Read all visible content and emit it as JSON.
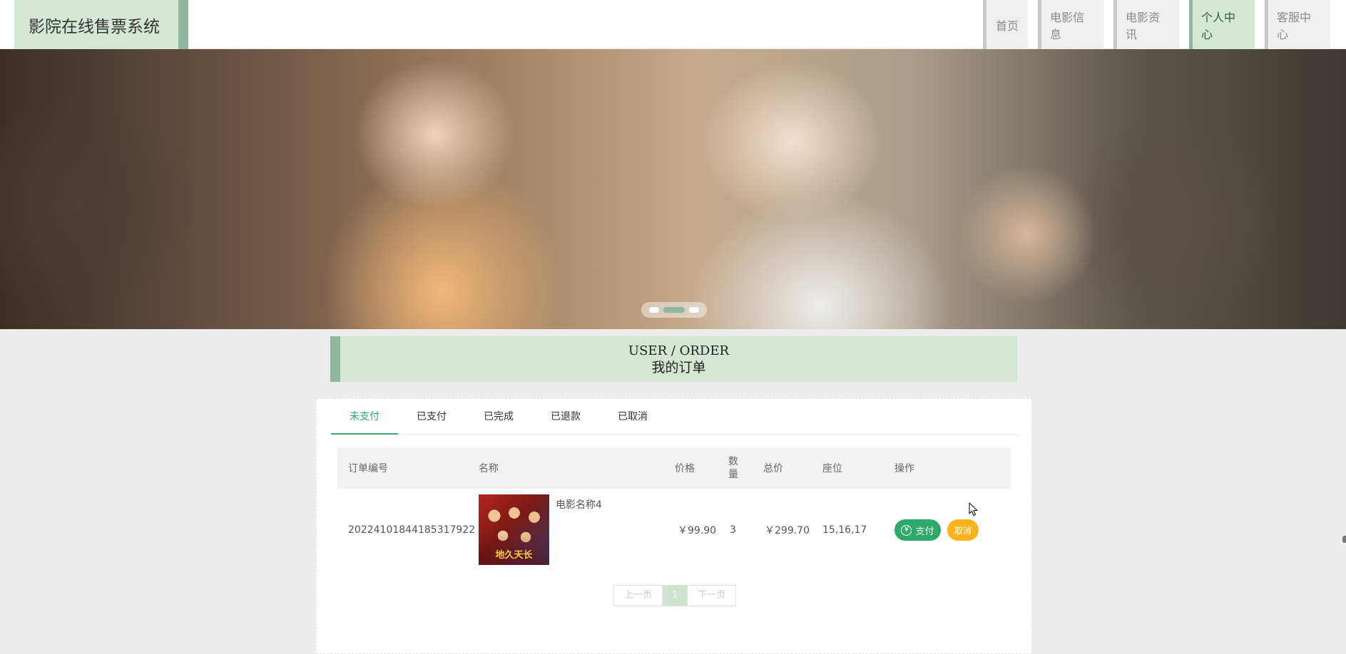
{
  "app": {
    "title": "影院在线售票系统"
  },
  "nav": {
    "items": [
      {
        "label": "首页",
        "active": false
      },
      {
        "label": "电影信息",
        "active": false
      },
      {
        "label": "电影资讯",
        "active": false
      },
      {
        "label": "个人中心",
        "active": true
      },
      {
        "label": "客服中心",
        "active": false
      }
    ]
  },
  "banner": {
    "slides": 3,
    "active_slide": 2
  },
  "section": {
    "title_en": "USER / ORDER",
    "title_zh": "我的订单"
  },
  "tabs": [
    {
      "label": "未支付",
      "active": true
    },
    {
      "label": "已支付",
      "active": false
    },
    {
      "label": "已完成",
      "active": false
    },
    {
      "label": "已退款",
      "active": false
    },
    {
      "label": "已取消",
      "active": false
    }
  ],
  "table": {
    "headers": {
      "order_no": "订单编号",
      "name": "名称",
      "price": "价格",
      "qty_line1": "数",
      "qty_line2": "量",
      "total": "总价",
      "seat": "座位",
      "action": "操作"
    },
    "rows": [
      {
        "order_no": "20224101844185317922",
        "name": "电影名称4",
        "poster_text": "地久天长",
        "price": "￥99.90",
        "qty": "3",
        "total": "￥299.70",
        "seat": "15,16,17",
        "pay_label": "支付",
        "cancel_label": "取消"
      }
    ]
  },
  "pagination": {
    "prev": "上一页",
    "current": "1",
    "next": "下一页"
  },
  "colors": {
    "accent_green": "#2fa86a",
    "light_green": "#d4e6d4",
    "mid_green": "#8fb69e",
    "cancel_orange": "#ffb31a"
  }
}
